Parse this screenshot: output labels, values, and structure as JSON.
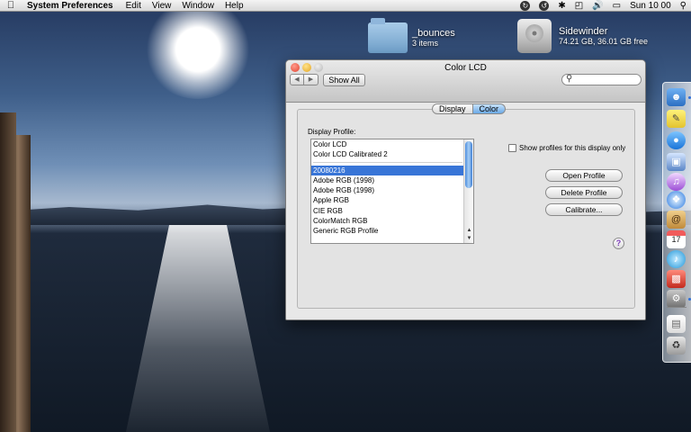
{
  "menubar": {
    "app_name": "System Preferences",
    "menus": [
      "Edit",
      "View",
      "Window",
      "Help"
    ],
    "clock": "Sun 10 00"
  },
  "desktop": {
    "folder": {
      "name": "_bounces",
      "sub": "3 items"
    },
    "disk": {
      "name": "Sidewinder",
      "sub": "74.21 GB, 36.01 GB free"
    }
  },
  "window": {
    "title": "Color LCD",
    "show_all": "Show All",
    "search": {
      "placeholder": "",
      "value": ""
    },
    "tabs": [
      {
        "label": "Display",
        "active": false
      },
      {
        "label": "Color",
        "active": true
      }
    ],
    "profile_label": "Display Profile:",
    "profiles_top": [
      "Color LCD",
      "Color LCD Calibrated 2"
    ],
    "profiles": [
      "20080216",
      "Adobe RGB (1998)",
      "Adobe RGB (1998)",
      "Apple RGB",
      "CIE RGB",
      "ColorMatch RGB",
      "Generic RGB Profile"
    ],
    "selected_profile": "20080216",
    "checkbox": {
      "label": "Show profiles for this display only",
      "checked": false
    },
    "buttons": {
      "open": "Open Profile",
      "delete": "Delete Profile",
      "calibrate": "Calibrate..."
    },
    "help": "?"
  },
  "dock": {
    "items": [
      "finder-icon",
      "stickies-icon",
      "ichat-icon",
      "preview-icon",
      "itunes-icon",
      "safari-icon",
      "ical-icon",
      "calendar-icon",
      "itunes-note-icon",
      "parallels-icon",
      "system-preferences-icon",
      "document-icon",
      "trash-icon"
    ]
  },
  "colors": {
    "accent": "#3875d7",
    "tab_active": "#6aa9e6"
  }
}
